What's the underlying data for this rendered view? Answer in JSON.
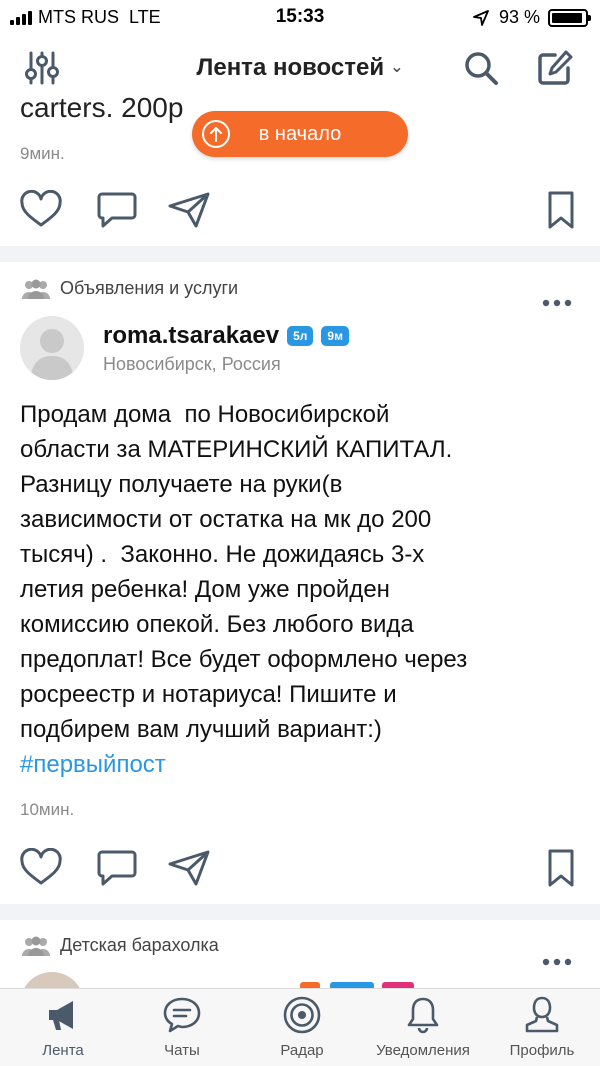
{
  "status_bar": {
    "carrier": "MTS RUS",
    "network": "LTE",
    "time": "15:33",
    "battery": "93 %",
    "battery_level": 0.93
  },
  "nav": {
    "title": "Лента новостей",
    "filter_icon": "sliders-icon",
    "search_icon": "search-icon",
    "compose_icon": "compose-icon"
  },
  "scroll_top_button": {
    "label": "в начало"
  },
  "previous_post": {
    "text": "carters. 200р",
    "time": "9мин."
  },
  "post": {
    "community": "Объявления и услуги",
    "author": "roma.tsarakaev",
    "badge_years": "5л",
    "badge_months": "9м",
    "location": "Новосибирск, Россия",
    "body_lines": [
      "Продам дома  по Новосибирской",
      "области за МАТЕРИНСКИЙ КАПИТАЛ.",
      "Разницу получаете на руки(в",
      "зависимости от остатка на мк до 200",
      "тысяч) .  Законно. Не дожидаясь 3-х",
      "летия ребенка! Дом уже пройден",
      "комиссию опекой. Без любого вида",
      "предоплат! Все будет оформлено через",
      "росреестр и нотариуса! Пишите и",
      "подбирем вам лучший вариант:)"
    ],
    "hashtag": "#первыйпост",
    "time": "10мин."
  },
  "next_post": {
    "community": "Детская барахолка"
  },
  "tabs": [
    {
      "label": "Лента",
      "icon": "megaphone-icon",
      "active": true
    },
    {
      "label": "Чаты",
      "icon": "chat-icon",
      "active": false
    },
    {
      "label": "Радар",
      "icon": "radar-icon",
      "active": false
    },
    {
      "label": "Уведомления",
      "icon": "bell-icon",
      "active": false
    },
    {
      "label": "Профиль",
      "icon": "profile-icon",
      "active": false
    }
  ],
  "colors": {
    "accent": "#f56b2a",
    "link": "#2a97e3",
    "icon": "#4a5a6a"
  }
}
